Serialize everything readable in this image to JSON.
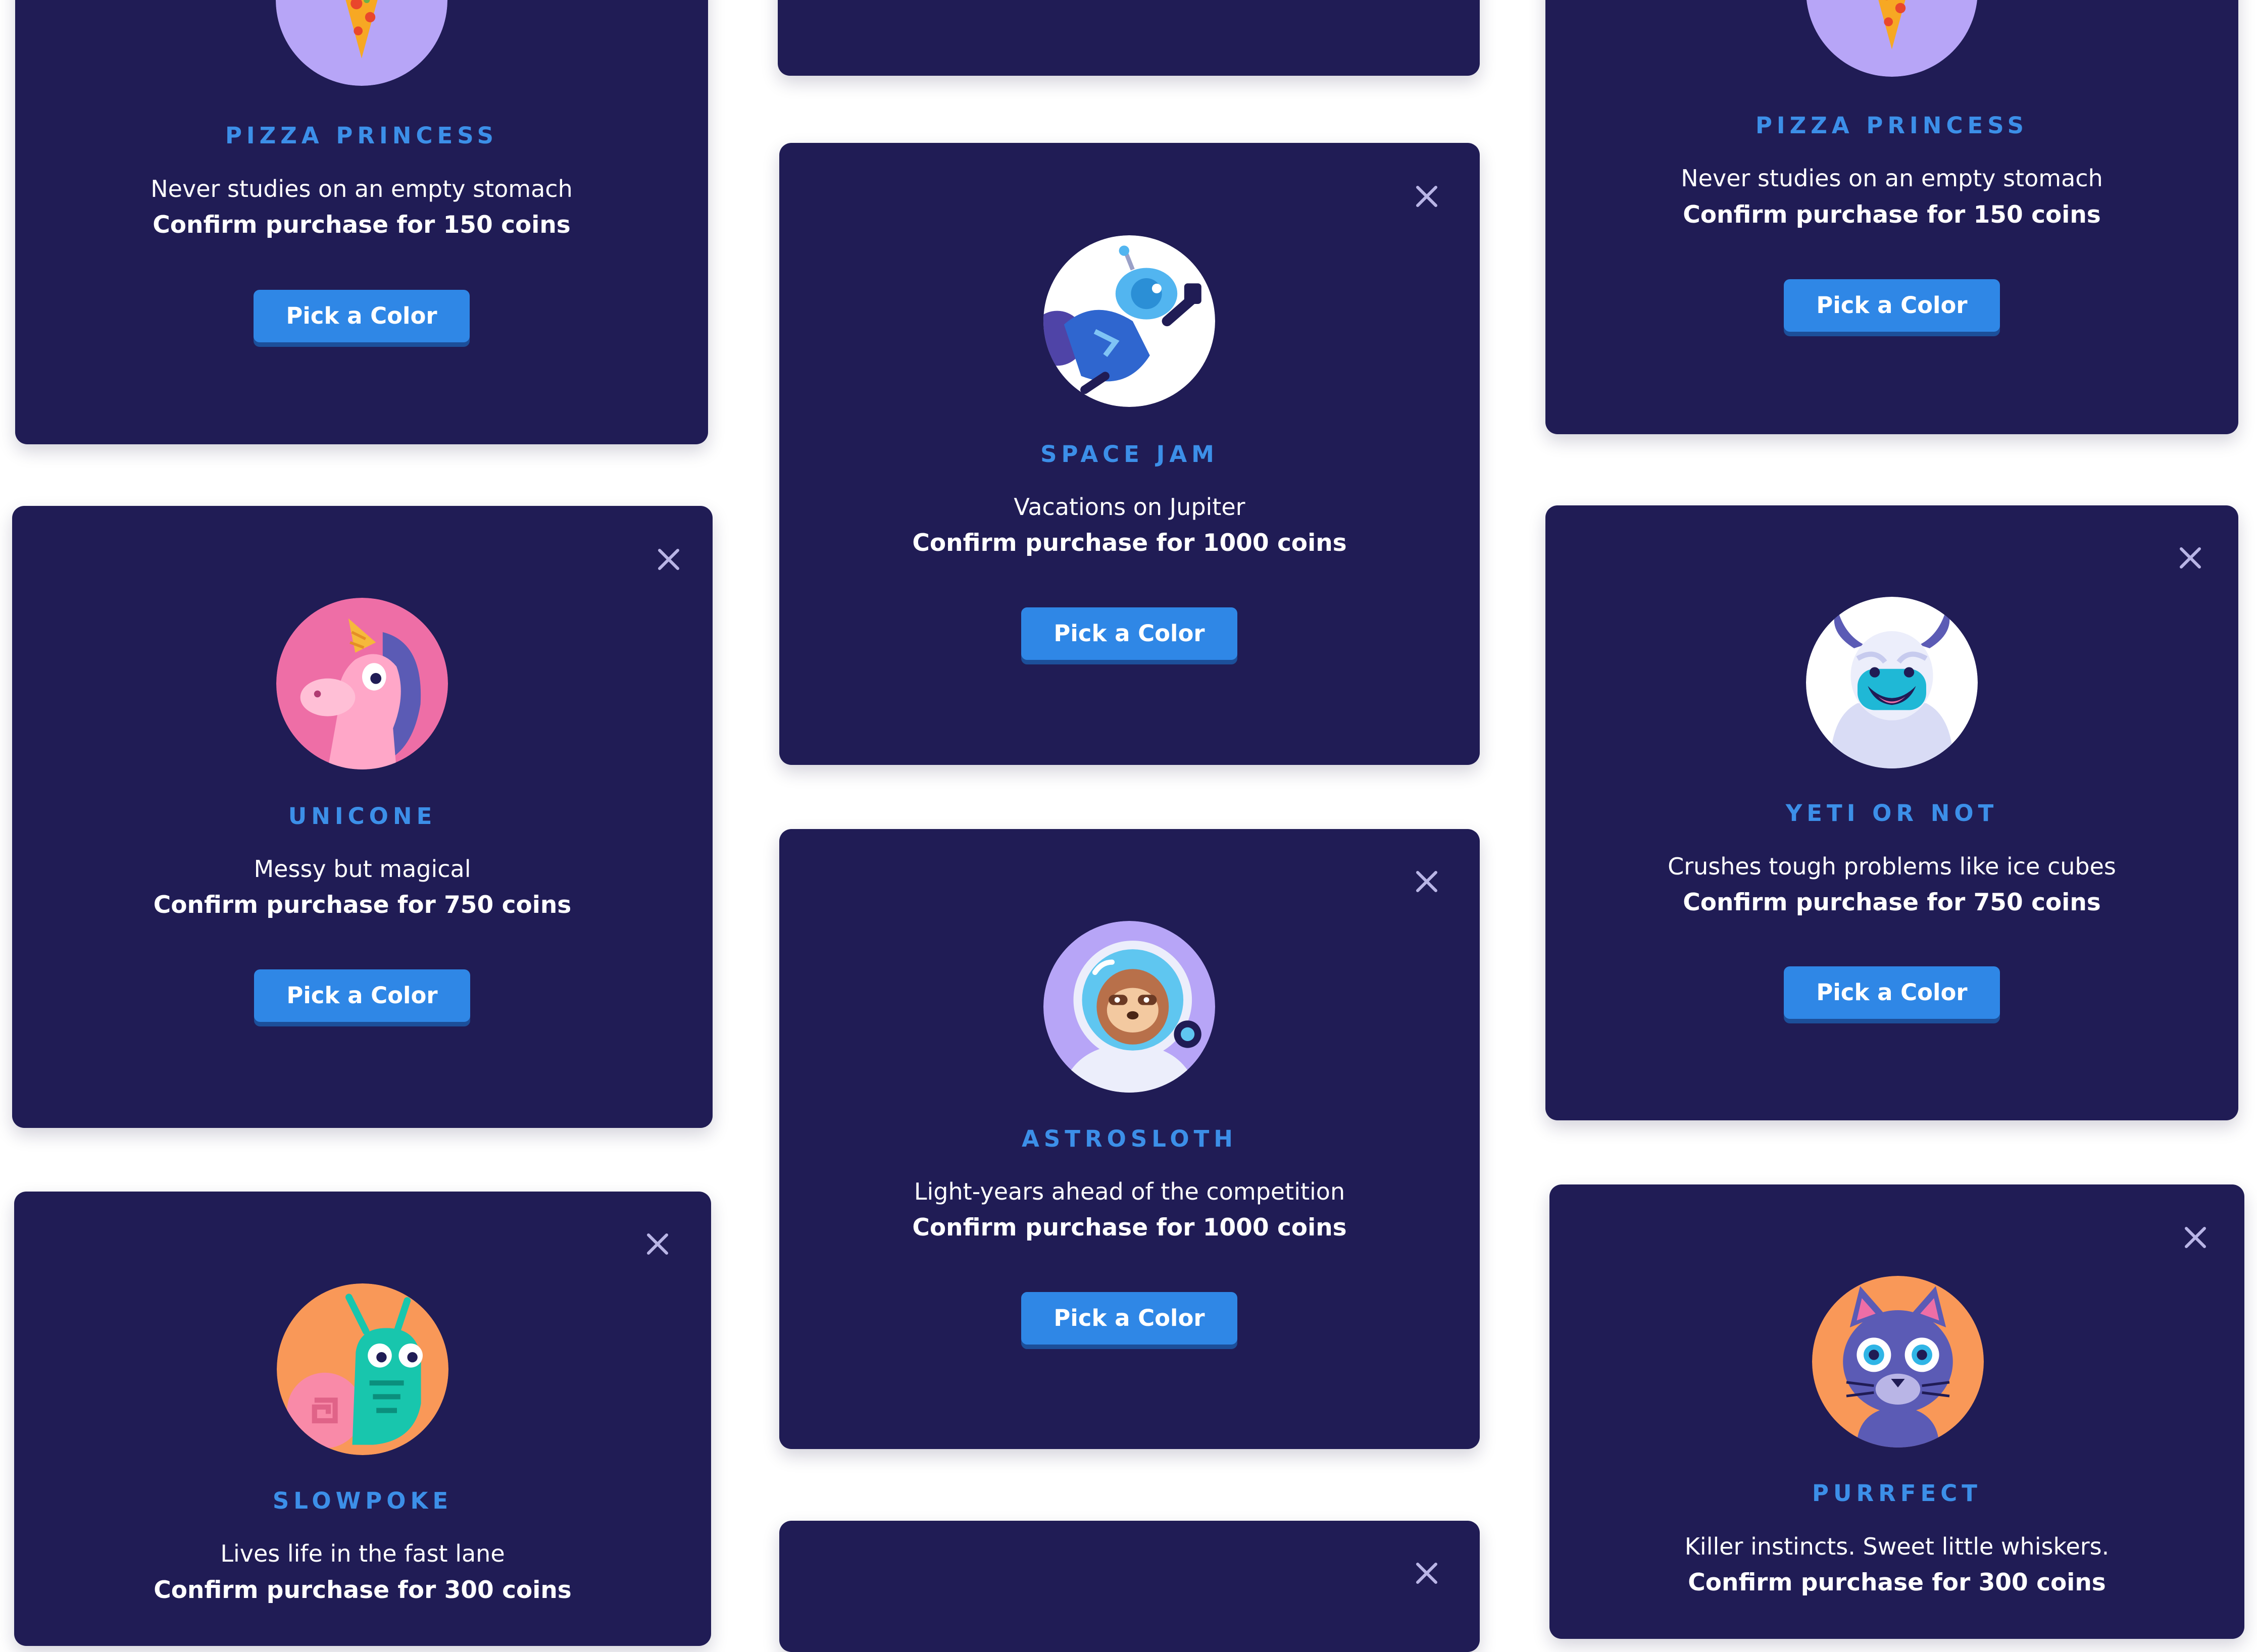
{
  "colors": {
    "page_background": "#ffffff",
    "card_background": "#201c55",
    "title_accent": "#3c8fe8",
    "button_blue": "#2f87e6",
    "button_shadow": "#1c4f9a",
    "close_icon": "#b9b5e6"
  },
  "cards": [
    {
      "character_name": "PIZZA PRINCESS",
      "tagline": "Never studies on an empty stomach",
      "confirm_text": "Confirm purchase for 150 coins",
      "button_label": "Pick a Color",
      "avatar_icon": "pizza-princess-icon",
      "avatar_bg": "#b7a5f7"
    },
    {
      "character_name": "",
      "tagline": "",
      "confirm_text": "",
      "button_label": ""
    },
    {
      "character_name": "PIZZA PRINCESS",
      "tagline": "Never studies on an empty stomach",
      "confirm_text": "Confirm purchase for 150 coins",
      "button_label": "Pick a Color",
      "avatar_icon": "pizza-princess-icon",
      "avatar_bg": "#b7a5f7"
    },
    {
      "character_name": "UNICONE",
      "tagline": "Messy but magical",
      "confirm_text": "Confirm purchase for 750 coins",
      "button_label": "Pick a Color",
      "avatar_icon": "unicorn-icon",
      "avatar_bg": "#ee6ea6"
    },
    {
      "character_name": "SPACE JAM",
      "tagline": "Vacations on Jupiter",
      "confirm_text": "Confirm purchase for 1000 coins",
      "button_label": "Pick a Color",
      "avatar_icon": "astronaut-robot-icon",
      "avatar_bg": "#ffffff"
    },
    {
      "character_name": "YETI OR NOT",
      "tagline": "Crushes tough problems like ice cubes",
      "confirm_text": "Confirm purchase for 750 coins",
      "button_label": "Pick a Color",
      "avatar_icon": "yeti-icon",
      "avatar_bg": "#ffffff"
    },
    {
      "character_name": "ASTROSLOTH",
      "tagline": "Light-years ahead of the competition",
      "confirm_text": "Confirm purchase for 1000 coins",
      "button_label": "Pick a Color",
      "avatar_icon": "astro-sloth-icon",
      "avatar_bg": "#b7a5f7"
    },
    {
      "character_name": "SLOWPOKE",
      "tagline": "Lives life in the fast lane",
      "confirm_text": "Confirm purchase for 300 coins",
      "button_label": "Pick a Color",
      "avatar_icon": "snail-icon",
      "avatar_bg": "#f99858"
    },
    {
      "character_name": "PURRFECT",
      "tagline": "Killer instincts. Sweet little whiskers.",
      "confirm_text": "Confirm purchase for 300 coins",
      "button_label": "Pick a Color",
      "avatar_icon": "cat-icon",
      "avatar_bg": "#f99858"
    },
    {
      "character_name": "",
      "tagline": "",
      "confirm_text": "",
      "button_label": ""
    }
  ]
}
